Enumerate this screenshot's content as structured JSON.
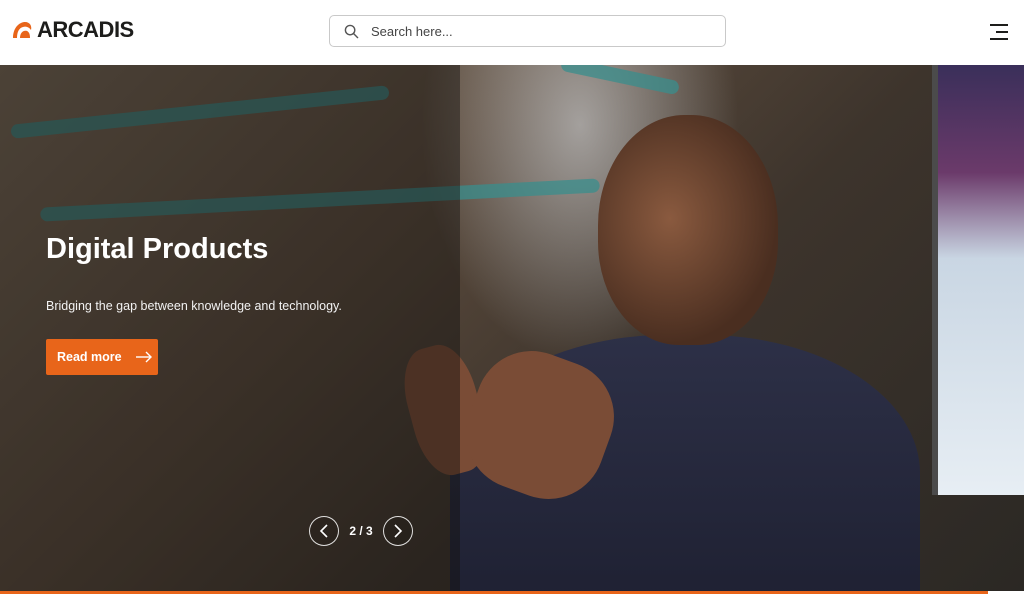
{
  "header": {
    "logo_text": "ARCADIS",
    "search": {
      "placeholder": "Search here..."
    },
    "menu_icon": "hamburger-menu-icon"
  },
  "hero": {
    "title": "Digital Products",
    "subtitle": "Bridging the gap between knowledge and technology.",
    "cta_label": "Read more",
    "cta_icon": "arrow-right-icon"
  },
  "carousel": {
    "counter": "2 / 3",
    "current": 2,
    "total": 3,
    "prev_icon": "chevron-left-icon",
    "next_icon": "chevron-right-icon",
    "progress": 0.965
  },
  "colors": {
    "brand_orange": "#e8651a",
    "text_dark": "#1d1d1b",
    "white": "#ffffff"
  }
}
